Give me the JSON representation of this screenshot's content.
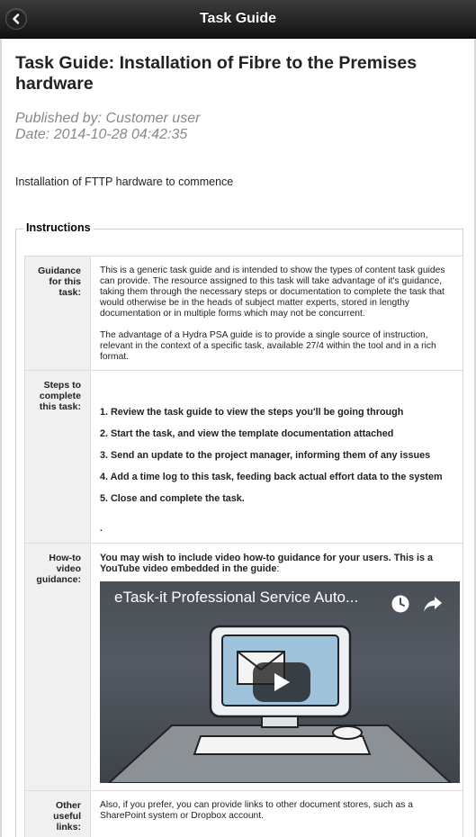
{
  "header": {
    "title": "Task Guide",
    "back_icon": "chevron-left-icon"
  },
  "guide": {
    "title": "Task Guide: Installation of Fibre to the Premises hardware",
    "published_by": "Published by: Customer user",
    "date": "Date: 2014-10-28 04:42:35",
    "description": "Installation of FTTP hardware to commence"
  },
  "instructions": {
    "legend": "Instructions",
    "guidance": {
      "label": "Guidance for this task:",
      "para1": "This is a generic task guide and is intended to show the types of content task guides can provide. The resource assigned to this task will take advantage of it's guidance, taking them through the necessary steps or documentation to complete the task that would otherwise be in the heads of subject matter experts, stored in lengthy documentation or in multiple forms which may not be concurrent.",
      "para2": "The advantage of a Hydra PSA guide is to provide a single source of instruction, relevant in the context of a specific task, available 27/4 within the tool and in a rich format."
    },
    "steps": {
      "label": "Steps to complete this task:",
      "items": [
        "1. Review the task guide to view the steps you'll be going through",
        "2. Start the task, and view the template documentation attached",
        "3. Send an update to the project manager, informing them of any issues",
        "4. Add a time log to this task, feeding back actual effort data to the system",
        "5. Close and complete the task."
      ],
      "trailing": "."
    },
    "howto": {
      "label": "How-to video guidance:",
      "intro_bold": "You may wish to include video how-to guidance for your users. This is a YouTube video embedded in the guide",
      "intro_tail": ":",
      "video_title": "eTask-it Professional Service Auto...",
      "video_icons": [
        "clock-icon",
        "share-icon",
        "play-icon"
      ]
    },
    "links": {
      "label": "Other useful links:",
      "text": "Also, if you prefer, you can provide links to other document stores, such as a SharePoint system or Dropbox account."
    }
  },
  "colors": {
    "header_bg": "#1f1f1f",
    "label_bg": "#f0f0f0",
    "meta_text": "#888888",
    "video_bg": "#4a4f56"
  }
}
